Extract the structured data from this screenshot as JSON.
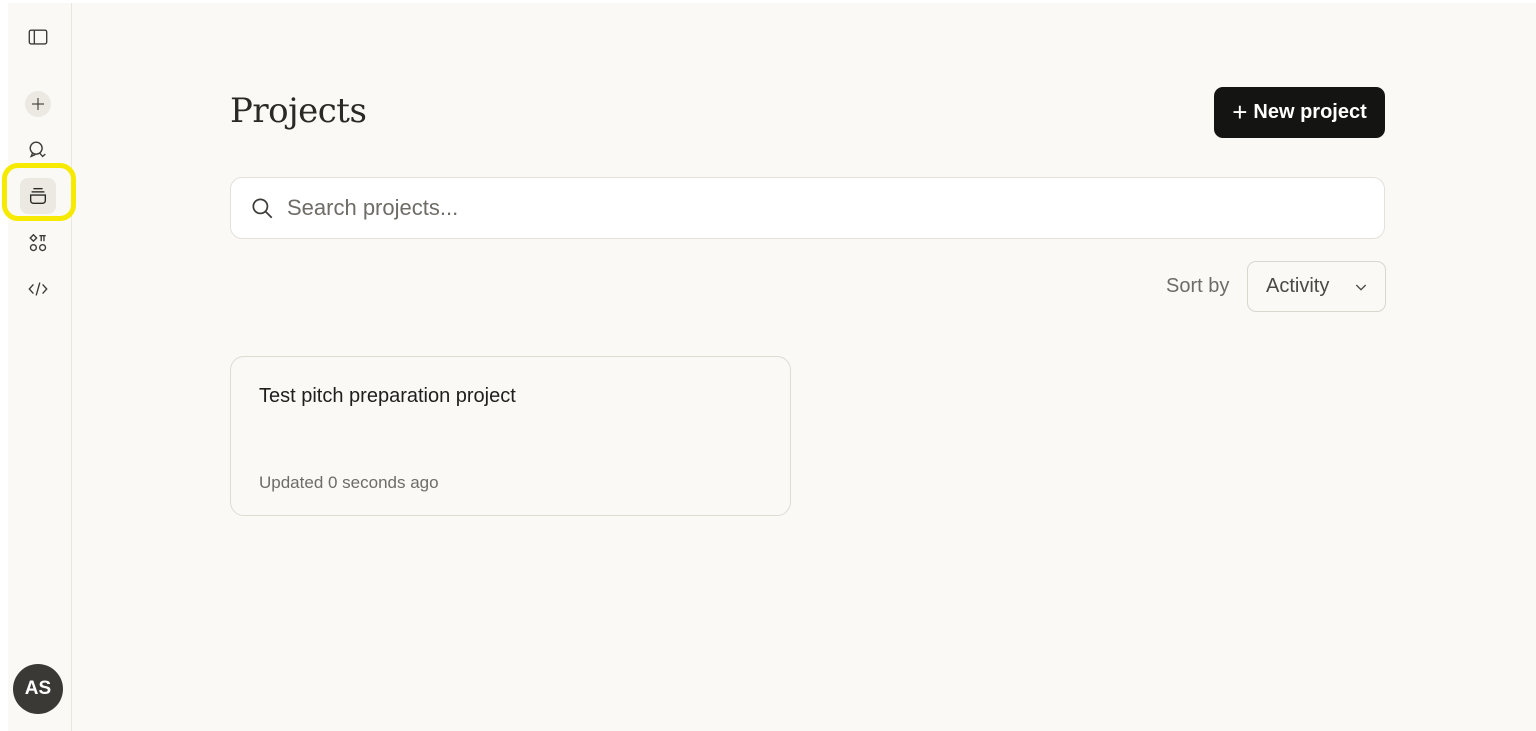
{
  "sidebar": {
    "toggle_icon": "sidebar-toggle-icon",
    "new_chat_icon": "plus-icon",
    "chats_icon": "chat-bubbles-icon",
    "projects_icon": "projects-stack-icon",
    "artifacts_icon": "shapes-icon",
    "code_icon": "code-icon",
    "highlight_color": "#f5ea00",
    "avatar_initials": "AS"
  },
  "main": {
    "title": "Projects",
    "new_project_plus": "+",
    "new_project_label": "New project",
    "search": {
      "placeholder": "Search projects...",
      "value": ""
    },
    "sort": {
      "label": "Sort by",
      "selected": "Activity"
    },
    "projects": [
      {
        "name": "Test pitch preparation project",
        "updated": "Updated 0 seconds ago"
      }
    ]
  },
  "colors": {
    "background": "#faf9f6",
    "primary_button": "#141413",
    "text": "#1f1e1d",
    "muted_text": "#6e6c66"
  }
}
